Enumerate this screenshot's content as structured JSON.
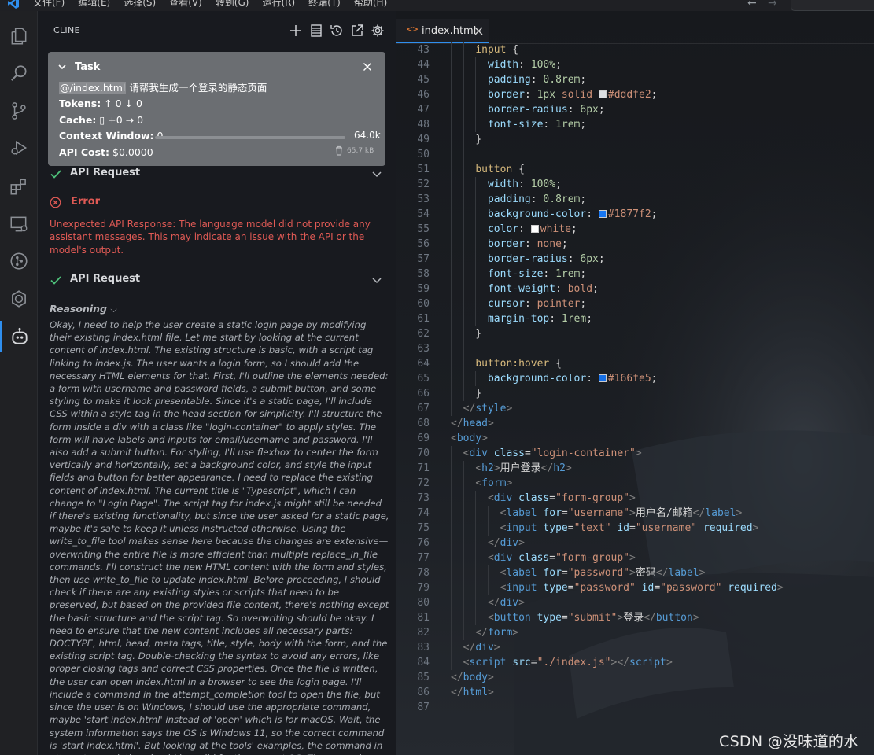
{
  "menu": {
    "items": [
      "文件(F)",
      "编辑(E)",
      "选择(S)",
      "查看(V)",
      "转到(G)",
      "运行(R)",
      "终端(T)",
      "帮助(H)"
    ]
  },
  "sidebar": {
    "title": "CLINE"
  },
  "task": {
    "label": "Task",
    "mention": "@/index.html",
    "message": " 请帮我生成一个登录的静态页面",
    "tokens_label": "Tokens:",
    "tokens_value": "↑ 0 ↓ 0",
    "cache_label": "Cache:",
    "cache_value": "+0 → 0",
    "context_label": "Context Window:",
    "context_used": "0",
    "context_max": "64.0k",
    "context_fraction": 0.0,
    "cost_label": "API Cost:",
    "cost_value": "$0.0000",
    "size": "65.7 kB"
  },
  "messages": {
    "api_request_1": "API Request",
    "error_title": "Error",
    "error_text": "Unexpected API Response: The language model did not provide any assistant messages. This may indicate an issue with the API or the model's output.",
    "api_request_2": "API Request",
    "reasoning_label": "Reasoning",
    "reasoning_text": "Okay, I need to help the user create a static login page by modifying their existing index.html file. Let me start by looking at the current content of index.html. The existing structure is basic, with a script tag linking to index.js. The user wants a login form, so I should add the necessary HTML elements for that. First, I'll outline the elements needed: a form with username and password fields, a submit button, and some styling to make it look presentable. Since it's a static page, I'll include CSS within a style tag in the head section for simplicity. I'll structure the form inside a div with a class like \"login-container\" to apply styles. The form will have labels and inputs for email/username and password. I'll also add a submit button. For styling, I'll use flexbox to center the form vertically and horizontally, set a background color, and style the input fields and button for better appearance. I need to replace the existing content of index.html. The current title is \"Typescript\", which I can change to \"Login Page\". The script tag for index.js might still be needed if there's existing functionality, but since the user asked for a static page, maybe it's safe to keep it unless instructed otherwise. Using the write_to_file tool makes sense here because the changes are extensive—overwriting the entire file is more efficient than multiple replace_in_file commands. I'll construct the new HTML content with the form and styles, then use write_to_file to update index.html. Before proceeding, I should check if there are any existing styles or scripts that need to be preserved, but based on the provided file content, there's nothing except the basic structure and the script tag. So overwriting should be okay. I need to ensure that the new content includes all necessary parts: DOCTYPE, html, head, meta tags, title, style, body with the form, and the existing script tag. Double-checking the syntax to avoid any errors, like proper closing tags and correct CSS properties. Once the file is written, the user can open index.html in a browser to see the login page. I'll include a command in the attempt_completion tool to open the file, but since the user is on Windows, I should use the appropriate command, maybe 'start index.html' instead of 'open' which is for macOS. Wait, the system information says the OS is Windows 11, so the correct command is 'start index.html'. But looking at the tools' examples, the command in attempt_completion should be valid for the current OS. The example uses"
  },
  "editor": {
    "tab_name": "index.html",
    "tab_icon": "<>",
    "lines": [
      {
        "n": "43",
        "i": 2,
        "t": [
          [
            "sel",
            "input "
          ],
          [
            "pl",
            "{"
          ]
        ]
      },
      {
        "n": "44",
        "i": 3,
        "t": [
          [
            "prop",
            "width"
          ],
          [
            "pl",
            ": "
          ],
          [
            "num",
            "100%"
          ],
          [
            "pl",
            ";"
          ]
        ]
      },
      {
        "n": "45",
        "i": 3,
        "t": [
          [
            "prop",
            "padding"
          ],
          [
            "pl",
            ": "
          ],
          [
            "num",
            "0.8rem"
          ],
          [
            "pl",
            ";"
          ]
        ]
      },
      {
        "n": "46",
        "i": 3,
        "t": [
          [
            "prop",
            "border"
          ],
          [
            "pl",
            ": "
          ],
          [
            "num",
            "1px"
          ],
          [
            "pl",
            " "
          ],
          [
            "kw",
            "solid "
          ],
          [
            "sw",
            "#dddfe2"
          ],
          [
            "kw",
            "#dddfe2"
          ],
          [
            "pl",
            ";"
          ]
        ]
      },
      {
        "n": "47",
        "i": 3,
        "t": [
          [
            "prop",
            "border-radius"
          ],
          [
            "pl",
            ": "
          ],
          [
            "num",
            "6px"
          ],
          [
            "pl",
            ";"
          ]
        ]
      },
      {
        "n": "48",
        "i": 3,
        "t": [
          [
            "prop",
            "font-size"
          ],
          [
            "pl",
            ": "
          ],
          [
            "num",
            "1rem"
          ],
          [
            "pl",
            ";"
          ]
        ]
      },
      {
        "n": "49",
        "i": 2,
        "t": [
          [
            "pl",
            "}"
          ]
        ]
      },
      {
        "n": "50",
        "i": 2,
        "t": []
      },
      {
        "n": "51",
        "i": 2,
        "t": [
          [
            "sel",
            "button "
          ],
          [
            "pl",
            "{"
          ]
        ]
      },
      {
        "n": "52",
        "i": 3,
        "t": [
          [
            "prop",
            "width"
          ],
          [
            "pl",
            ": "
          ],
          [
            "num",
            "100%"
          ],
          [
            "pl",
            ";"
          ]
        ]
      },
      {
        "n": "53",
        "i": 3,
        "t": [
          [
            "prop",
            "padding"
          ],
          [
            "pl",
            ": "
          ],
          [
            "num",
            "0.8rem"
          ],
          [
            "pl",
            ";"
          ]
        ]
      },
      {
        "n": "54",
        "i": 3,
        "t": [
          [
            "prop",
            "background-color"
          ],
          [
            "pl",
            ": "
          ],
          [
            "sw",
            "#1877f2"
          ],
          [
            "kw",
            "#1877f2"
          ],
          [
            "pl",
            ";"
          ]
        ]
      },
      {
        "n": "55",
        "i": 3,
        "t": [
          [
            "prop",
            "color"
          ],
          [
            "pl",
            ": "
          ],
          [
            "sw",
            "#ffffff"
          ],
          [
            "kw",
            "white"
          ],
          [
            "pl",
            ";"
          ]
        ]
      },
      {
        "n": "56",
        "i": 3,
        "t": [
          [
            "prop",
            "border"
          ],
          [
            "pl",
            ": "
          ],
          [
            "kw",
            "none"
          ],
          [
            "pl",
            ";"
          ]
        ]
      },
      {
        "n": "57",
        "i": 3,
        "t": [
          [
            "prop",
            "border-radius"
          ],
          [
            "pl",
            ": "
          ],
          [
            "num",
            "6px"
          ],
          [
            "pl",
            ";"
          ]
        ]
      },
      {
        "n": "58",
        "i": 3,
        "t": [
          [
            "prop",
            "font-size"
          ],
          [
            "pl",
            ": "
          ],
          [
            "num",
            "1rem"
          ],
          [
            "pl",
            ";"
          ]
        ]
      },
      {
        "n": "59",
        "i": 3,
        "t": [
          [
            "prop",
            "font-weight"
          ],
          [
            "pl",
            ": "
          ],
          [
            "kw",
            "bold"
          ],
          [
            "pl",
            ";"
          ]
        ]
      },
      {
        "n": "60",
        "i": 3,
        "t": [
          [
            "prop",
            "cursor"
          ],
          [
            "pl",
            ": "
          ],
          [
            "kw",
            "pointer"
          ],
          [
            "pl",
            ";"
          ]
        ]
      },
      {
        "n": "61",
        "i": 3,
        "t": [
          [
            "prop",
            "margin-top"
          ],
          [
            "pl",
            ": "
          ],
          [
            "num",
            "1rem"
          ],
          [
            "pl",
            ";"
          ]
        ]
      },
      {
        "n": "62",
        "i": 2,
        "t": [
          [
            "pl",
            "}"
          ]
        ]
      },
      {
        "n": "63",
        "i": 2,
        "t": []
      },
      {
        "n": "64",
        "i": 2,
        "t": [
          [
            "sel",
            "button:hover "
          ],
          [
            "pl",
            "{"
          ]
        ]
      },
      {
        "n": "65",
        "i": 3,
        "t": [
          [
            "prop",
            "background-color"
          ],
          [
            "pl",
            ": "
          ],
          [
            "sw",
            "#166fe5"
          ],
          [
            "kw",
            "#166fe5"
          ],
          [
            "pl",
            ";"
          ]
        ]
      },
      {
        "n": "66",
        "i": 2,
        "t": [
          [
            "pl",
            "}"
          ]
        ]
      },
      {
        "n": "67",
        "i": 1,
        "t": [
          [
            "br",
            "</"
          ],
          [
            "tag",
            "style"
          ],
          [
            "br",
            ">"
          ]
        ]
      },
      {
        "n": "68",
        "i": 0,
        "t": [
          [
            "br",
            "</"
          ],
          [
            "tag",
            "head"
          ],
          [
            "br",
            ">"
          ]
        ]
      },
      {
        "n": "69",
        "i": 0,
        "t": [
          [
            "br",
            "<"
          ],
          [
            "tag",
            "body"
          ],
          [
            "br",
            ">"
          ]
        ]
      },
      {
        "n": "70",
        "i": 1,
        "t": [
          [
            "br",
            "<"
          ],
          [
            "tag",
            "div "
          ],
          [
            "attr",
            "class"
          ],
          [
            "pl",
            "="
          ],
          [
            "aval",
            "\"login-container\""
          ],
          [
            "br",
            ">"
          ]
        ]
      },
      {
        "n": "71",
        "i": 2,
        "t": [
          [
            "br",
            "<"
          ],
          [
            "tag",
            "h2"
          ],
          [
            "br",
            ">"
          ],
          [
            "pl",
            "用户登录"
          ],
          [
            "br",
            "</"
          ],
          [
            "tag",
            "h2"
          ],
          [
            "br",
            ">"
          ]
        ]
      },
      {
        "n": "72",
        "i": 2,
        "t": [
          [
            "br",
            "<"
          ],
          [
            "tag",
            "form"
          ],
          [
            "br",
            ">"
          ]
        ]
      },
      {
        "n": "73",
        "i": 3,
        "t": [
          [
            "br",
            "<"
          ],
          [
            "tag",
            "div "
          ],
          [
            "attr",
            "class"
          ],
          [
            "pl",
            "="
          ],
          [
            "aval",
            "\"form-group\""
          ],
          [
            "br",
            ">"
          ]
        ]
      },
      {
        "n": "74",
        "i": 4,
        "t": [
          [
            "br",
            "<"
          ],
          [
            "tag",
            "label "
          ],
          [
            "attr",
            "for"
          ],
          [
            "pl",
            "="
          ],
          [
            "aval",
            "\"username\""
          ],
          [
            "br",
            ">"
          ],
          [
            "pl",
            "用户名/邮箱"
          ],
          [
            "br",
            "</"
          ],
          [
            "tag",
            "label"
          ],
          [
            "br",
            ">"
          ]
        ]
      },
      {
        "n": "75",
        "i": 4,
        "t": [
          [
            "br",
            "<"
          ],
          [
            "tag",
            "input "
          ],
          [
            "attr",
            "type"
          ],
          [
            "pl",
            "="
          ],
          [
            "aval",
            "\"text\" "
          ],
          [
            "attr",
            "id"
          ],
          [
            "pl",
            "="
          ],
          [
            "aval",
            "\"username\" "
          ],
          [
            "attr",
            "required"
          ],
          [
            "br",
            ">"
          ]
        ]
      },
      {
        "n": "76",
        "i": 3,
        "t": [
          [
            "br",
            "</"
          ],
          [
            "tag",
            "div"
          ],
          [
            "br",
            ">"
          ]
        ]
      },
      {
        "n": "77",
        "i": 3,
        "t": [
          [
            "br",
            "<"
          ],
          [
            "tag",
            "div "
          ],
          [
            "attr",
            "class"
          ],
          [
            "pl",
            "="
          ],
          [
            "aval",
            "\"form-group\""
          ],
          [
            "br",
            ">"
          ]
        ]
      },
      {
        "n": "78",
        "i": 4,
        "t": [
          [
            "br",
            "<"
          ],
          [
            "tag",
            "label "
          ],
          [
            "attr",
            "for"
          ],
          [
            "pl",
            "="
          ],
          [
            "aval",
            "\"password\""
          ],
          [
            "br",
            ">"
          ],
          [
            "pl",
            "密码"
          ],
          [
            "br",
            "</"
          ],
          [
            "tag",
            "label"
          ],
          [
            "br",
            ">"
          ]
        ]
      },
      {
        "n": "79",
        "i": 4,
        "t": [
          [
            "br",
            "<"
          ],
          [
            "tag",
            "input "
          ],
          [
            "attr",
            "type"
          ],
          [
            "pl",
            "="
          ],
          [
            "aval",
            "\"password\" "
          ],
          [
            "attr",
            "id"
          ],
          [
            "pl",
            "="
          ],
          [
            "aval",
            "\"password\" "
          ],
          [
            "attr",
            "required"
          ],
          [
            "br",
            ">"
          ]
        ]
      },
      {
        "n": "80",
        "i": 3,
        "t": [
          [
            "br",
            "</"
          ],
          [
            "tag",
            "div"
          ],
          [
            "br",
            ">"
          ]
        ]
      },
      {
        "n": "81",
        "i": 3,
        "t": [
          [
            "br",
            "<"
          ],
          [
            "tag",
            "button "
          ],
          [
            "attr",
            "type"
          ],
          [
            "pl",
            "="
          ],
          [
            "aval",
            "\"submit\""
          ],
          [
            "br",
            ">"
          ],
          [
            "pl",
            "登录"
          ],
          [
            "br",
            "</"
          ],
          [
            "tag",
            "button"
          ],
          [
            "br",
            ">"
          ]
        ]
      },
      {
        "n": "82",
        "i": 2,
        "t": [
          [
            "br",
            "</"
          ],
          [
            "tag",
            "form"
          ],
          [
            "br",
            ">"
          ]
        ]
      },
      {
        "n": "83",
        "i": 1,
        "t": [
          [
            "br",
            "</"
          ],
          [
            "tag",
            "div"
          ],
          [
            "br",
            ">"
          ]
        ]
      },
      {
        "n": "84",
        "i": 1,
        "t": [
          [
            "br",
            "<"
          ],
          [
            "tag",
            "script "
          ],
          [
            "attr",
            "src"
          ],
          [
            "pl",
            "="
          ],
          [
            "aval",
            "\"./index.js\""
          ],
          [
            "br",
            "></"
          ],
          [
            "tag",
            "script"
          ],
          [
            "br",
            ">"
          ]
        ]
      },
      {
        "n": "85",
        "i": 0,
        "t": [
          [
            "br",
            "</"
          ],
          [
            "tag",
            "body"
          ],
          [
            "br",
            ">"
          ]
        ]
      },
      {
        "n": "86",
        "i": 0,
        "t": [
          [
            "br",
            "</"
          ],
          [
            "tag",
            "html"
          ],
          [
            "br",
            ">"
          ]
        ]
      },
      {
        "n": "87",
        "i": 0,
        "t": []
      }
    ]
  },
  "watermark": "CSDN @没味道的水",
  "colors": {
    "accent": "#2f8fef",
    "error": "#e05a55",
    "success": "#4ec07a",
    "task_bg": "#6b6e72"
  }
}
